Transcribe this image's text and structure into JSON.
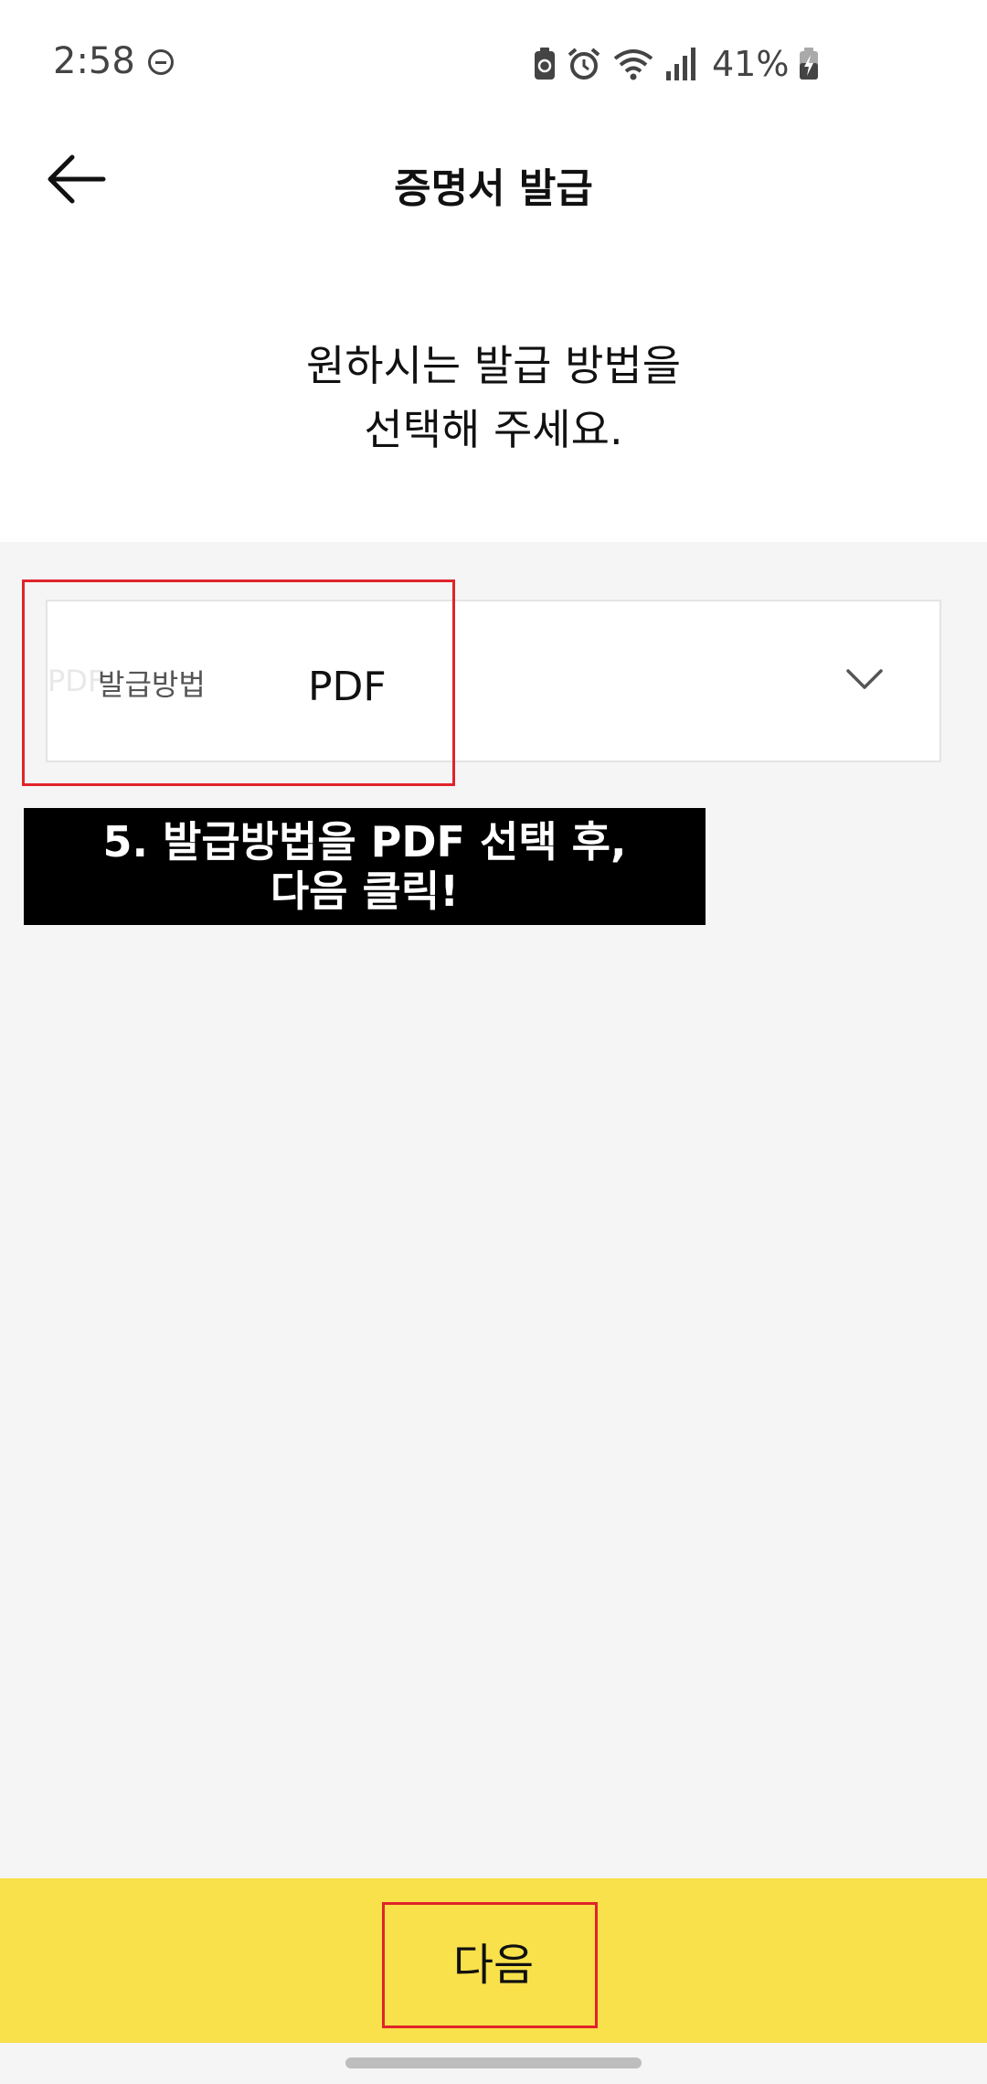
{
  "status_bar": {
    "time": "2:58",
    "battery_percent": "41%",
    "icons": [
      "do-not-disturb-icon",
      "recycle-battery-icon",
      "alarm-icon",
      "wifi-icon",
      "signal-icon",
      "battery-charging-icon"
    ]
  },
  "header": {
    "title": "증명서 발급",
    "back_icon": "arrow-left-icon"
  },
  "instruction": {
    "line1": "원하시는 발급 방법을",
    "line2": "선택해 주세요."
  },
  "dropdown": {
    "ghost_text": "PDF",
    "label": "발급방법",
    "value": "PDF",
    "icon": "chevron-down-icon"
  },
  "caption": {
    "line1": "5. 발급방법을 PDF 선택 후,",
    "line2": "다음 클릭!"
  },
  "bottom": {
    "next_label": "다음"
  },
  "colors": {
    "accent_yellow": "#f8e14b",
    "highlight_red": "#e0242a",
    "caption_bg": "#000000",
    "page_bg": "#f5f5f5"
  }
}
